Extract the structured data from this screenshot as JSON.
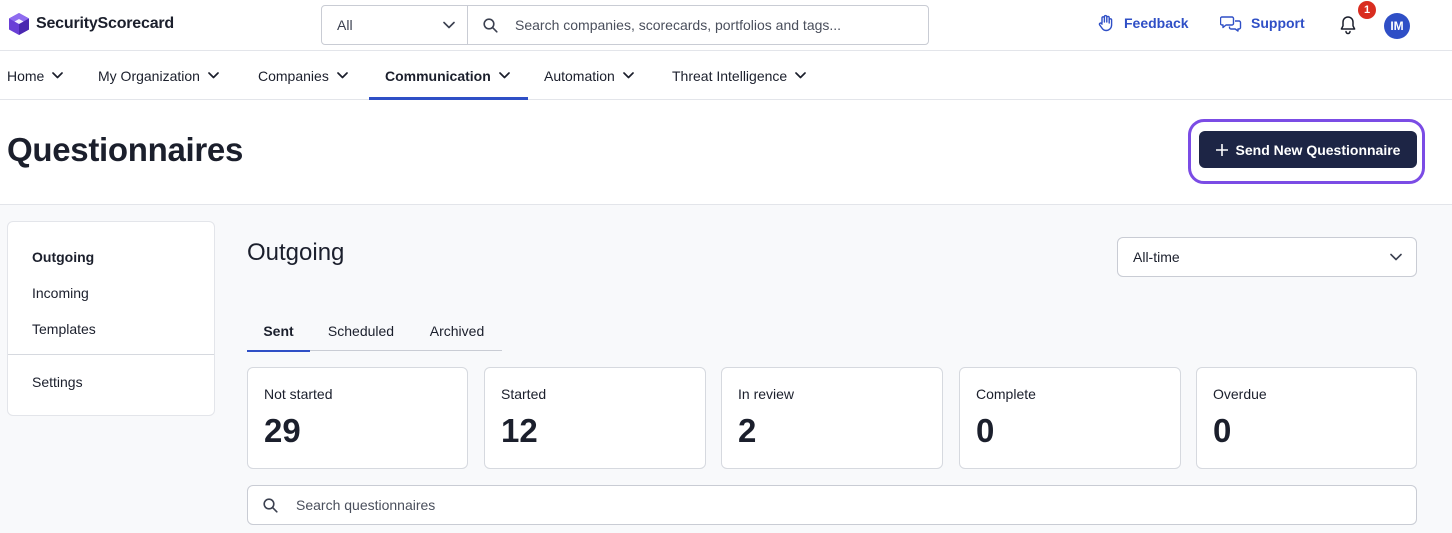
{
  "brand": {
    "name": "SecurityScorecard",
    "logo_icon": "hexagon-cube-icon",
    "color": "#6a3fd6"
  },
  "header": {
    "scope_select": {
      "value": "All"
    },
    "search": {
      "placeholder": "Search companies, scorecards, portfolios and tags..."
    },
    "feedback_label": "Feedback",
    "support_label": "Support",
    "notification_count": "1",
    "avatar_initials": "IM"
  },
  "nav": {
    "items": [
      {
        "label": "Home"
      },
      {
        "label": "My Organization"
      },
      {
        "label": "Companies"
      },
      {
        "label": "Communication",
        "active": true
      },
      {
        "label": "Automation"
      },
      {
        "label": "Threat Intelligence"
      }
    ]
  },
  "page": {
    "title": "Questionnaires",
    "send_button_label": "Send New Questionnaire"
  },
  "sidebar": {
    "items": [
      {
        "label": "Outgoing",
        "active": true
      },
      {
        "label": "Incoming"
      },
      {
        "label": "Templates"
      },
      {
        "label": "Settings"
      }
    ]
  },
  "main": {
    "section_title": "Outgoing",
    "time_filter": {
      "value": "All-time"
    },
    "tabs": [
      {
        "label": "Sent",
        "active": true
      },
      {
        "label": "Scheduled"
      },
      {
        "label": "Archived"
      }
    ],
    "stats": [
      {
        "label": "Not started",
        "value": "29"
      },
      {
        "label": "Started",
        "value": "12"
      },
      {
        "label": "In review",
        "value": "2"
      },
      {
        "label": "Complete",
        "value": "0"
      },
      {
        "label": "Overdue",
        "value": "0"
      }
    ],
    "search": {
      "placeholder": "Search questionnaires"
    }
  },
  "colors": {
    "accent": "#2f4fc6",
    "primary_button": "#1d2545",
    "highlight": "#7b4ce5",
    "badge": "#d92d20"
  }
}
